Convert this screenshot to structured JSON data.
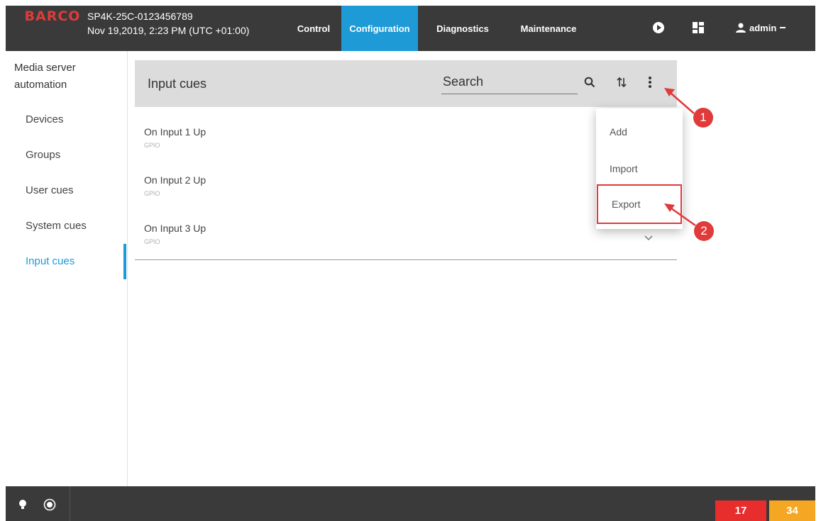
{
  "header": {
    "logo_text": "BARCO",
    "device_id": "SP4K-25C-0123456789",
    "device_time": "Nov 19,2019, 2:23 PM (UTC +01:00)",
    "tabs": [
      {
        "label": "Control",
        "active": false
      },
      {
        "label": "Configuration",
        "active": true
      },
      {
        "label": "Diagnostics",
        "active": false
      },
      {
        "label": "Maintenance",
        "active": false
      }
    ],
    "icons": [
      "play-circle-icon",
      "dashboard-grid-icon",
      "user-icon"
    ],
    "user": "admin",
    "accent_color": "#1e9ad6",
    "bar_color": "#3a3a3a"
  },
  "sidebar": {
    "title": "Media server automation",
    "items": [
      {
        "label": "Devices",
        "active": false
      },
      {
        "label": "Groups",
        "active": false
      },
      {
        "label": "User cues",
        "active": false
      },
      {
        "label": "System cues",
        "active": false
      },
      {
        "label": "Input cues",
        "active": true
      }
    ]
  },
  "main": {
    "title": "Input cues",
    "search_placeholder": "Search",
    "header_icons": [
      "search-icon",
      "sort-icon",
      "more-vert-icon"
    ],
    "rows": [
      {
        "name": "On Input 1 Up",
        "type": "GPIO"
      },
      {
        "name": "On Input 2 Up",
        "type": "GPIO"
      },
      {
        "name": "On Input 3 Up",
        "type": "GPIO"
      }
    ]
  },
  "menu": {
    "items": [
      {
        "label": "Add"
      },
      {
        "label": "Import"
      },
      {
        "label": "Export"
      }
    ],
    "highlight_color": "#e03a3a"
  },
  "callouts": [
    "1",
    "2"
  ],
  "footer": {
    "icons": [
      "lightbulb-icon",
      "radio-target-icon"
    ],
    "counters": [
      {
        "value": "17",
        "color": "#e82d2d"
      },
      {
        "value": "34",
        "color": "#f5a623"
      }
    ]
  }
}
